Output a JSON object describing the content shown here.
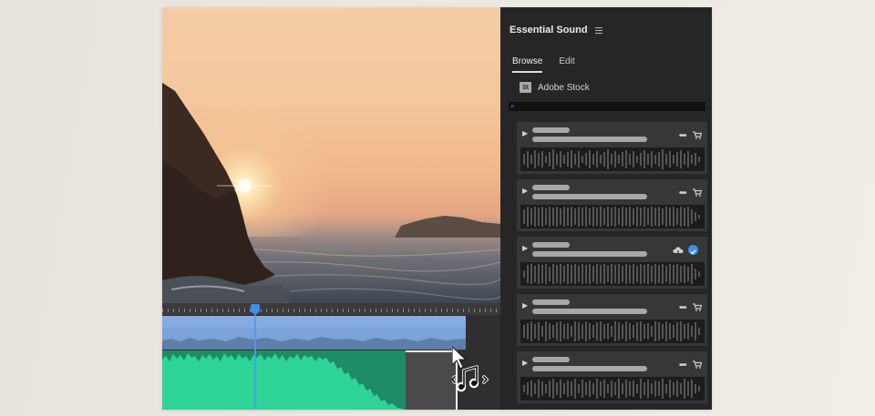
{
  "panel": {
    "title": "Essential Sound",
    "tabs": [
      {
        "label": "Browse",
        "active": true
      },
      {
        "label": "Edit",
        "active": false
      }
    ],
    "source": {
      "badge": "St",
      "label": "Adobe Stock"
    },
    "search": {
      "placeholder": "",
      "icon": "search-icon"
    }
  },
  "tracks": [
    {
      "state": "cart",
      "icons": [
        "more-icon",
        "cart-icon"
      ]
    },
    {
      "state": "cart",
      "icons": [
        "more-icon",
        "cart-icon"
      ]
    },
    {
      "state": "licensed",
      "icons": [
        "cloud-download-icon",
        "check-circle-icon"
      ]
    },
    {
      "state": "cart",
      "icons": [
        "more-icon",
        "cart-icon"
      ]
    },
    {
      "state": "cart",
      "icons": [
        "more-icon",
        "cart-icon"
      ]
    }
  ],
  "colors": {
    "accent": "#3d8ff0",
    "audio_clip": "#2ecc96",
    "video_clip": "#7aa3d9",
    "panel_bg": "#262626"
  }
}
